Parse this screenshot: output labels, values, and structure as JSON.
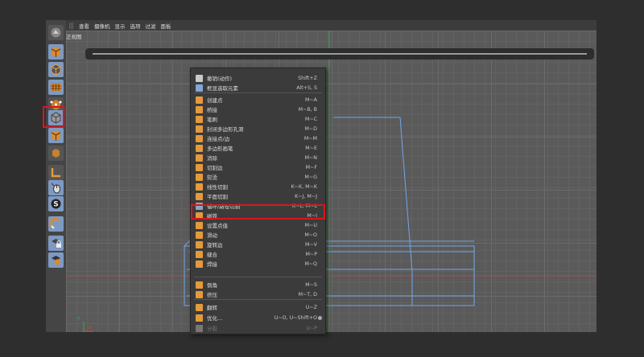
{
  "menubar": {
    "items": [
      "查看",
      "摄像机",
      "显示",
      "选项",
      "过滤",
      "面板"
    ]
  },
  "viewport": {
    "label": "正视图"
  },
  "axis": {
    "y": "y",
    "x": "x"
  },
  "toolbar": {
    "tools": [
      {
        "name": "object-mode",
        "icon": "cube-icon"
      },
      {
        "name": "model-mode",
        "icon": "cube-outline-icon"
      },
      {
        "name": "texture-mode",
        "icon": "checker-icon"
      },
      {
        "name": "point-mode",
        "icon": "points-icon"
      },
      {
        "name": "edge-mode",
        "icon": "edges-icon"
      },
      {
        "name": "polygon-mode",
        "icon": "polygon-icon"
      },
      {
        "name": "axis-mode",
        "icon": "axis-icon"
      },
      {
        "name": "tweak-mode",
        "icon": "mouse-icon"
      },
      {
        "name": "snap",
        "icon": "snap-s-icon"
      },
      {
        "name": "magnet",
        "icon": "magnet-icon"
      },
      {
        "name": "lock-workplane",
        "icon": "lock-icon"
      },
      {
        "name": "planar-workplane",
        "icon": "grid-icon"
      }
    ]
  },
  "menu": {
    "items": [
      {
        "label": "撤销(动作)",
        "shortcut": "Shift+Z",
        "color": "#c9c9c9"
      },
      {
        "label": "框显选取元素",
        "shortcut": "Alt+S, S",
        "color": "#7ea7d8"
      },
      {
        "label": "创建点",
        "shortcut": "M~A",
        "color": "#e39a3c"
      },
      {
        "label": "桥接",
        "shortcut": "M~B, B",
        "color": "#e39a3c"
      },
      {
        "label": "笔刷",
        "shortcut": "M~C",
        "color": "#e39a3c"
      },
      {
        "label": "封闭多边形孔洞",
        "shortcut": "M~D",
        "color": "#e39a3c"
      },
      {
        "label": "连接点/边",
        "shortcut": "M~M",
        "color": "#e39a3c"
      },
      {
        "label": "多边形画笔",
        "shortcut": "M~E",
        "color": "#e39a3c"
      },
      {
        "label": "消除",
        "shortcut": "M~N",
        "color": "#e39a3c"
      },
      {
        "label": "切割边",
        "shortcut": "M~F",
        "color": "#e39a3c"
      },
      {
        "label": "熨烫",
        "shortcut": "M~G",
        "color": "#e39a3c"
      },
      {
        "label": "线性切割",
        "shortcut": "K~K, M~K",
        "color": "#e39a3c"
      },
      {
        "label": "平面切割",
        "shortcut": "K~J, M~J",
        "color": "#e39a3c"
      },
      {
        "label": "循环/路径切割",
        "shortcut": "K~L, M~L",
        "color": "#8fa3c0"
      },
      {
        "label": "磁铁",
        "shortcut": "M~I",
        "color": "#e39a3c"
      },
      {
        "label": "设置点值",
        "shortcut": "M~U",
        "color": "#e39a3c"
      },
      {
        "label": "滑动",
        "shortcut": "M~O",
        "color": "#e39a3c"
      },
      {
        "label": "旋转边",
        "shortcut": "M~V",
        "color": "#e39a3c"
      },
      {
        "label": "缝合",
        "shortcut": "M~P",
        "color": "#e39a3c"
      },
      {
        "label": "焊接",
        "shortcut": "M~Q",
        "color": "#e39a3c"
      },
      {
        "label": "倒角",
        "shortcut": "M~S",
        "color": "#e39a3c"
      },
      {
        "label": "挤压",
        "shortcut": "M~T, D",
        "color": "#e39a3c"
      },
      {
        "label": "翻转",
        "shortcut": "U~Z",
        "color": "#e39a3c"
      },
      {
        "label": "优化...",
        "shortcut": "U~O, U~Shift+O",
        "color": "#e39a3c"
      },
      {
        "label": "分裂",
        "shortcut": "U~P",
        "color": "#777777",
        "disabled": true
      }
    ]
  },
  "colors": {
    "highlight": "#d3191f",
    "wire": "#6fa8e8",
    "accent": "#7e9ac2"
  }
}
